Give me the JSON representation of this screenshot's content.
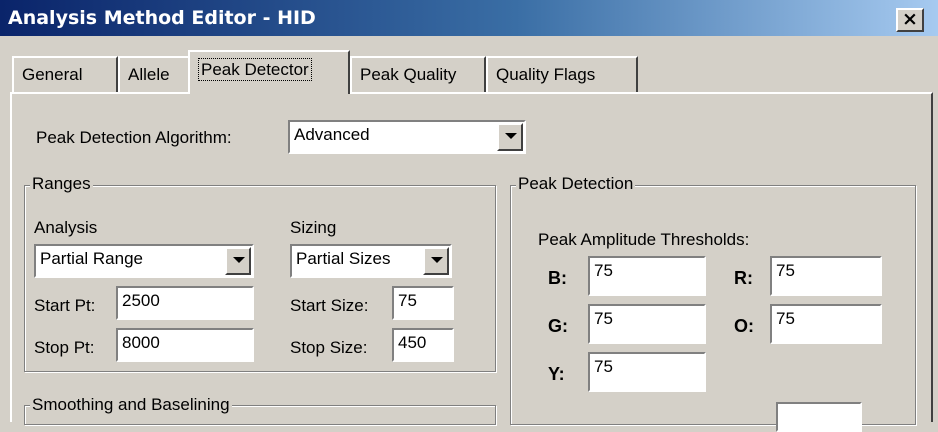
{
  "window": {
    "title": "Analysis Method Editor - HID",
    "close_label": "×"
  },
  "tabs": [
    {
      "label": "General"
    },
    {
      "label": "Allele"
    },
    {
      "label": "Peak Detector"
    },
    {
      "label": "Peak Quality"
    },
    {
      "label": "Quality Flags"
    }
  ],
  "algorithm": {
    "label": "Peak Detection Algorithm:",
    "value": "Advanced"
  },
  "ranges": {
    "title": "Ranges",
    "analysis": {
      "heading": "Analysis",
      "mode": "Partial Range",
      "start_label": "Start Pt:",
      "start_value": "2500",
      "stop_label": "Stop Pt:",
      "stop_value": "8000"
    },
    "sizing": {
      "heading": "Sizing",
      "mode": "Partial Sizes",
      "start_label": "Start Size:",
      "start_value": "75",
      "stop_label": "Stop Size:",
      "stop_value": "450"
    }
  },
  "smoothing": {
    "title": "Smoothing and Baselining"
  },
  "peak_detection": {
    "title": "Peak Detection",
    "thresholds_label": "Peak Amplitude Thresholds:",
    "b_label": "B:",
    "b_value": "75",
    "r_label": "R:",
    "r_value": "75",
    "g_label": "G:",
    "g_value": "75",
    "o_label": "O:",
    "o_value": "75",
    "y_label": "Y:",
    "y_value": "75"
  }
}
